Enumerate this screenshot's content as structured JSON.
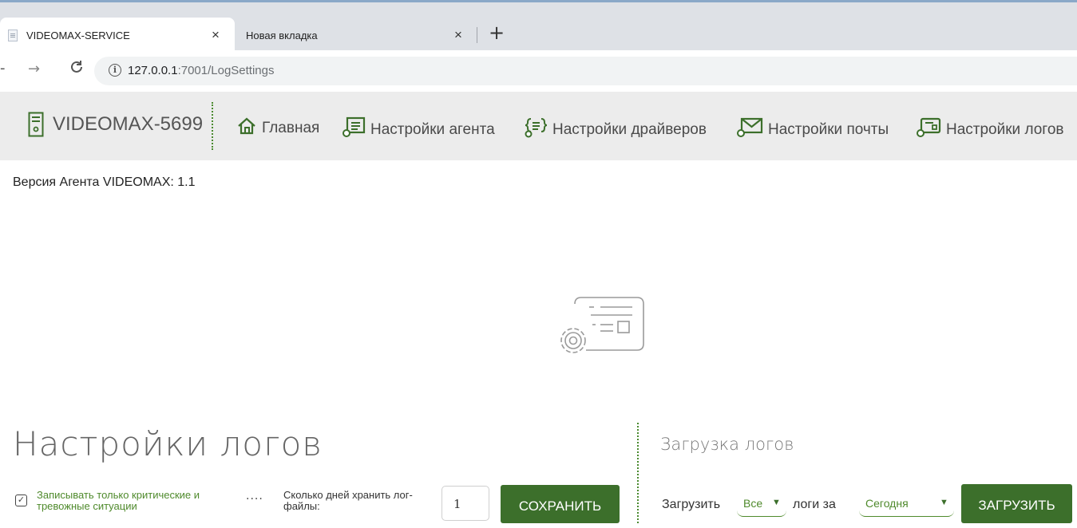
{
  "browser": {
    "tabs": [
      {
        "title": "VIDEOMAX-SERVICE",
        "active": true
      },
      {
        "title": "Новая вкладка",
        "active": false
      }
    ],
    "new_tab_label": "+",
    "close_glyph": "×",
    "url_host": "127.0.0.1",
    "url_rest": ":7001/LogSettings"
  },
  "header": {
    "brand": "VIDEOMAX-5699",
    "nav": [
      {
        "label": "Главная",
        "icon": "home-icon"
      },
      {
        "label": "Настройки агента",
        "icon": "agent-settings-icon"
      },
      {
        "label": "Настройки драйверов",
        "icon": "driver-settings-icon"
      },
      {
        "label": "Настройки почты",
        "icon": "mail-settings-icon"
      },
      {
        "label": "Настройки логов",
        "icon": "log-settings-icon"
      }
    ],
    "accent_color": "#4a8a2f"
  },
  "main": {
    "version_text": "Версия Агента VIDEOMAX: 1.1",
    "log_settings": {
      "title": "Настройки логов",
      "checkbox_label": "Записывать только критические и тревожные ситуации",
      "checkbox_checked": true,
      "dots": "....",
      "days_label": "Сколько дней хранить лог-файлы:",
      "days_value": "1",
      "save_button": "СОХРАНИТЬ"
    },
    "log_download": {
      "title": "Загрузка логов",
      "label_prefix": "Загрузить",
      "type_value": "Все",
      "label_middle": "логи за",
      "period_value": "Сегодня",
      "load_button": "ЗАГРУЗИТЬ"
    },
    "button_color": "#3c6f2b"
  }
}
